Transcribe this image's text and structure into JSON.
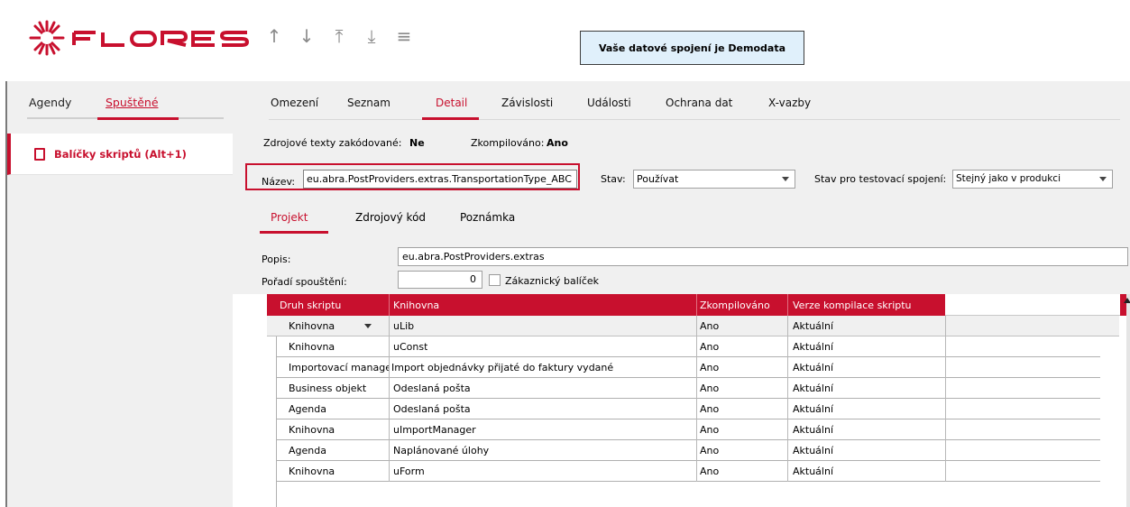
{
  "app": {
    "logo_text": "FLORES",
    "connection_notice": "Vaše datové spojení je Demodata"
  },
  "toolbar": {
    "icons": [
      "arrow-up-icon",
      "arrow-down-icon",
      "arrow-to-top-icon",
      "arrow-to-bottom-icon",
      "menu-icon"
    ]
  },
  "colors": {
    "accent": "#c8102e",
    "panel": "#f0f0f0",
    "notice_bg": "#e0f0fb"
  },
  "sidebar": {
    "tabs": [
      "Agendy",
      "Spuštěné"
    ],
    "active_tab": "Spuštěné",
    "items": [
      {
        "label": "Balíčky skriptů (Alt+1)",
        "icon": "document-icon"
      }
    ]
  },
  "main": {
    "tabs": [
      "Omezení",
      "Seznam",
      "Detail",
      "Závislosti",
      "Události",
      "Ochrana dat",
      "X-vazby"
    ],
    "active_tab": "Detail",
    "info": {
      "encoded_label": "Zdrojové texty zakódované:",
      "encoded_value": "Ne",
      "compiled_label": "Zkompilováno:",
      "compiled_value": "Ano"
    },
    "name": {
      "label": "Název:",
      "value": "eu.abra.PostProviders.extras.TransportationType_ABC"
    },
    "stav": {
      "label": "Stav:",
      "value": "Používat"
    },
    "stav_test": {
      "label": "Stav pro testovací spojení:",
      "value": "Stejný jako v produkci"
    },
    "sub_tabs": [
      "Projekt",
      "Zdrojový kód",
      "Poznámka"
    ],
    "active_sub_tab": "Projekt",
    "popis": {
      "label": "Popis:",
      "value": "eu.abra.PostProviders.extras"
    },
    "poradi": {
      "label": "Pořadí spouštění:",
      "value": "0"
    },
    "customer_package": {
      "label": "Zákaznický balíček",
      "checked": false
    },
    "grid": {
      "columns": [
        "Druh skriptu",
        "Knihovna",
        "Zkompilováno",
        "Verze kompilace skriptu"
      ],
      "rows": [
        [
          "Knihovna",
          "uLib",
          "Ano",
          "Aktuální"
        ],
        [
          "Knihovna",
          "uConst",
          "Ano",
          "Aktuální"
        ],
        [
          "Importovací manage",
          "Import objednávky přijaté do faktury vydané",
          "Ano",
          "Aktuální"
        ],
        [
          "Business objekt",
          "Odeslaná pošta",
          "Ano",
          "Aktuální"
        ],
        [
          "Agenda",
          "Odeslaná pošta",
          "Ano",
          "Aktuální"
        ],
        [
          "Knihovna",
          "uImportManager",
          "Ano",
          "Aktuální"
        ],
        [
          "Agenda",
          "Naplánované úlohy",
          "Ano",
          "Aktuální"
        ],
        [
          "Knihovna",
          "uForm",
          "Ano",
          "Aktuální"
        ]
      ]
    }
  }
}
